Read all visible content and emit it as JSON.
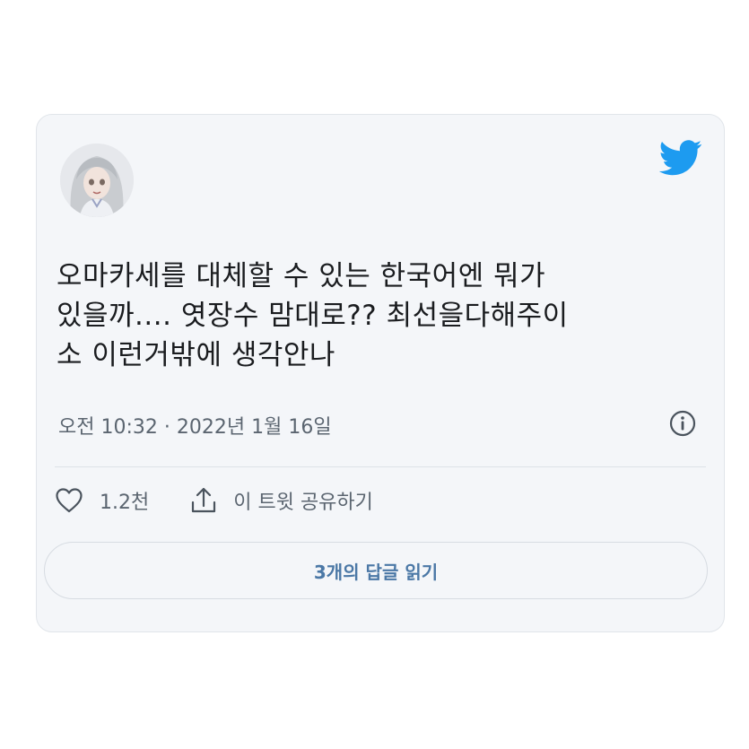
{
  "tweet": {
    "lines": [
      "오마카세를 대체할 수 있는 한국어엔 뭐가",
      "있을까.... 엿장수 맘대로?? 최선을다해주이",
      "소  이런거밖에 생각안나"
    ],
    "time": "오전 10:32",
    "separator": "·",
    "date": "2022년 1월 16일"
  },
  "actions": {
    "like_icon": "heart-icon",
    "like_count": "1.2천",
    "share_icon": "share-icon",
    "share_label": "이 트윗 공유하기"
  },
  "replies_button": {
    "label": "3개의 답글 읽기"
  },
  "icons": {
    "brand": "twitter-bird-icon",
    "info": "info-icon"
  },
  "colors": {
    "card_bg": "#f4f6f9",
    "twitter_blue": "#1d9bf0",
    "text": "#1a1c1f",
    "muted": "#5b6570",
    "link": "#4b78a6"
  }
}
